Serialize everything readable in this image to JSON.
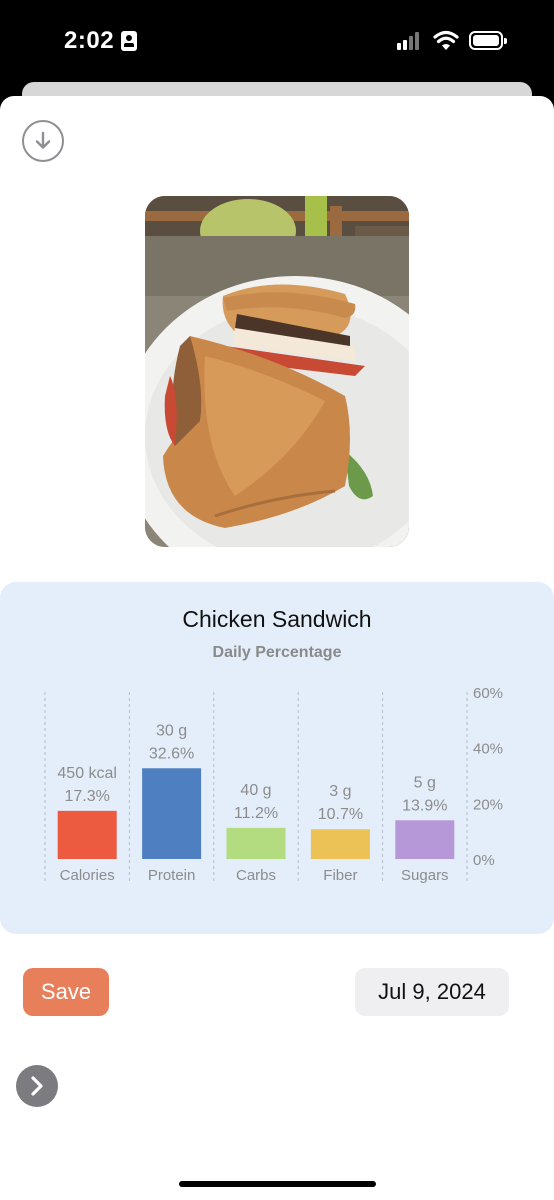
{
  "status_bar": {
    "time": "2:02",
    "icons": [
      "id-badge-icon",
      "signal-icon",
      "wifi-icon",
      "battery-icon"
    ]
  },
  "header": {
    "download_icon": "arrow-down-circle-icon"
  },
  "photo": {
    "description_icon": "food-photo"
  },
  "nutrition": {
    "title": "Chicken Sandwich",
    "subtitle": "Daily Percentage"
  },
  "chart_data": {
    "type": "bar",
    "title": "Chicken Sandwich",
    "subtitle": "Daily Percentage",
    "categories": [
      "Calories",
      "Protein",
      "Carbs",
      "Fiber",
      "Sugars"
    ],
    "amounts": [
      "450 kcal",
      "30 g",
      "40 g",
      "3 g",
      "5 g"
    ],
    "percent_labels": [
      "17.3%",
      "32.6%",
      "11.2%",
      "10.7%",
      "13.9%"
    ],
    "values": [
      17.3,
      32.6,
      11.2,
      10.7,
      13.9
    ],
    "colors": [
      "#ec5a3f",
      "#4e80c1",
      "#b2dc7f",
      "#ecc257",
      "#b697d8"
    ],
    "ylim": [
      0,
      60
    ],
    "yticks": [
      "0%",
      "20%",
      "40%",
      "60%"
    ],
    "ytick_values": [
      0,
      20,
      40,
      60
    ],
    "y_axis_position": "right",
    "grid": "vertical dashed"
  },
  "actions": {
    "save_label": "Save",
    "date": "Jul 9, 2024",
    "next_icon": "chevron-right-icon"
  }
}
